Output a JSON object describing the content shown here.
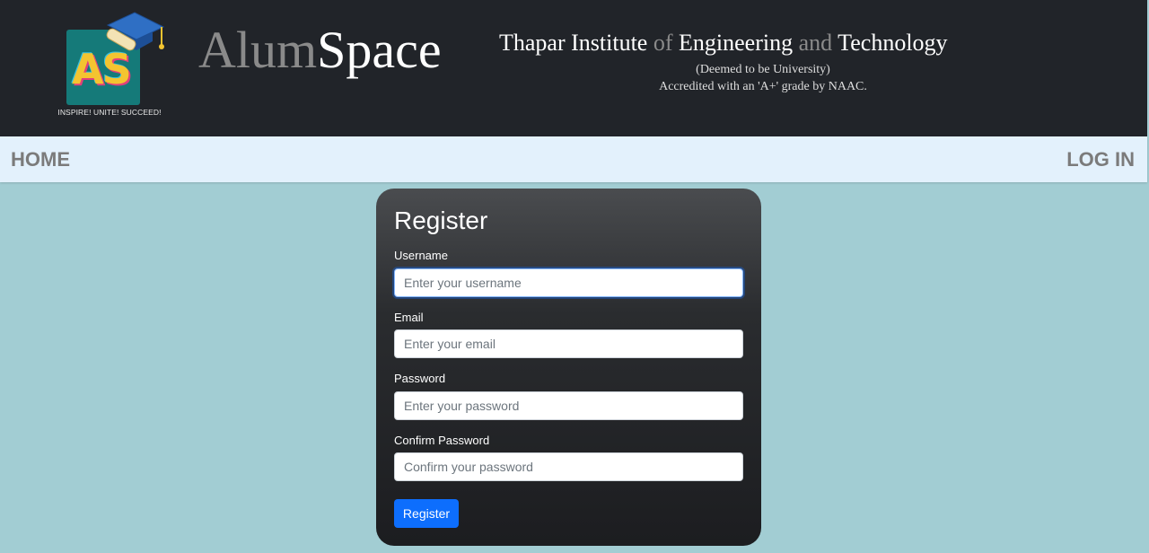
{
  "header": {
    "logo": {
      "letters": "AS",
      "tagline": "INSPIRE! UNITE! SUCCEED!"
    },
    "brand": {
      "part1": "Alum",
      "part2": "Space"
    },
    "institute": {
      "w1": "Thapar Institute",
      "w2": "of",
      "w3": "Engineering",
      "w4": "and",
      "w5": "Technology",
      "line1": "(Deemed to be University)",
      "line2": "Accredited with an 'A+' grade by NAAC."
    }
  },
  "nav": {
    "home": "HOME",
    "login": "LOG IN"
  },
  "form": {
    "title": "Register",
    "username": {
      "label": "Username",
      "placeholder": "Enter your username",
      "value": ""
    },
    "email": {
      "label": "Email",
      "placeholder": "Enter your email",
      "value": ""
    },
    "password": {
      "label": "Password",
      "placeholder": "Enter your password",
      "value": ""
    },
    "confirm": {
      "label": "Confirm Password",
      "placeholder": "Confirm your password",
      "value": ""
    },
    "submit": "Register"
  },
  "colors": {
    "header_bg": "#212429",
    "nav_bg": "#e3f1fc",
    "page_bg": "#a2cdd3",
    "accent": "#0d6efd",
    "logo_bg": "#157a79"
  }
}
